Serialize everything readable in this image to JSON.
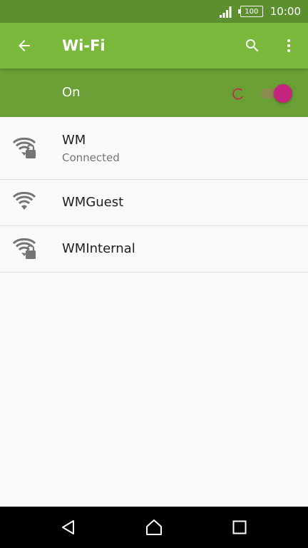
{
  "status_bar": {
    "battery_level": "100",
    "time": "10:00",
    "signal_icon": "signal-icon"
  },
  "app_bar": {
    "title": "Wi-Fi",
    "back_icon": "arrow-back-icon",
    "search_icon": "search-icon",
    "more_icon": "more-vert-icon"
  },
  "wifi_switch": {
    "label": "On",
    "state": "on",
    "scanning": true
  },
  "networks": [
    {
      "name": "WM",
      "status": "Connected",
      "secured": true,
      "signal": "full"
    },
    {
      "name": "WMGuest",
      "status": "",
      "secured": false,
      "signal": "full"
    },
    {
      "name": "WMInternal",
      "status": "",
      "secured": true,
      "signal": "full"
    }
  ],
  "nav_bar": {
    "back_icon": "nav-back-icon",
    "home_icon": "nav-home-icon",
    "recents_icon": "nav-recents-icon"
  },
  "colors": {
    "status_bar": "#5c8f2d",
    "app_bar": "#79b83a",
    "switch_bar": "#6a9f35",
    "toggle_thumb": "#c4247d",
    "icon_gray": "#757575"
  }
}
